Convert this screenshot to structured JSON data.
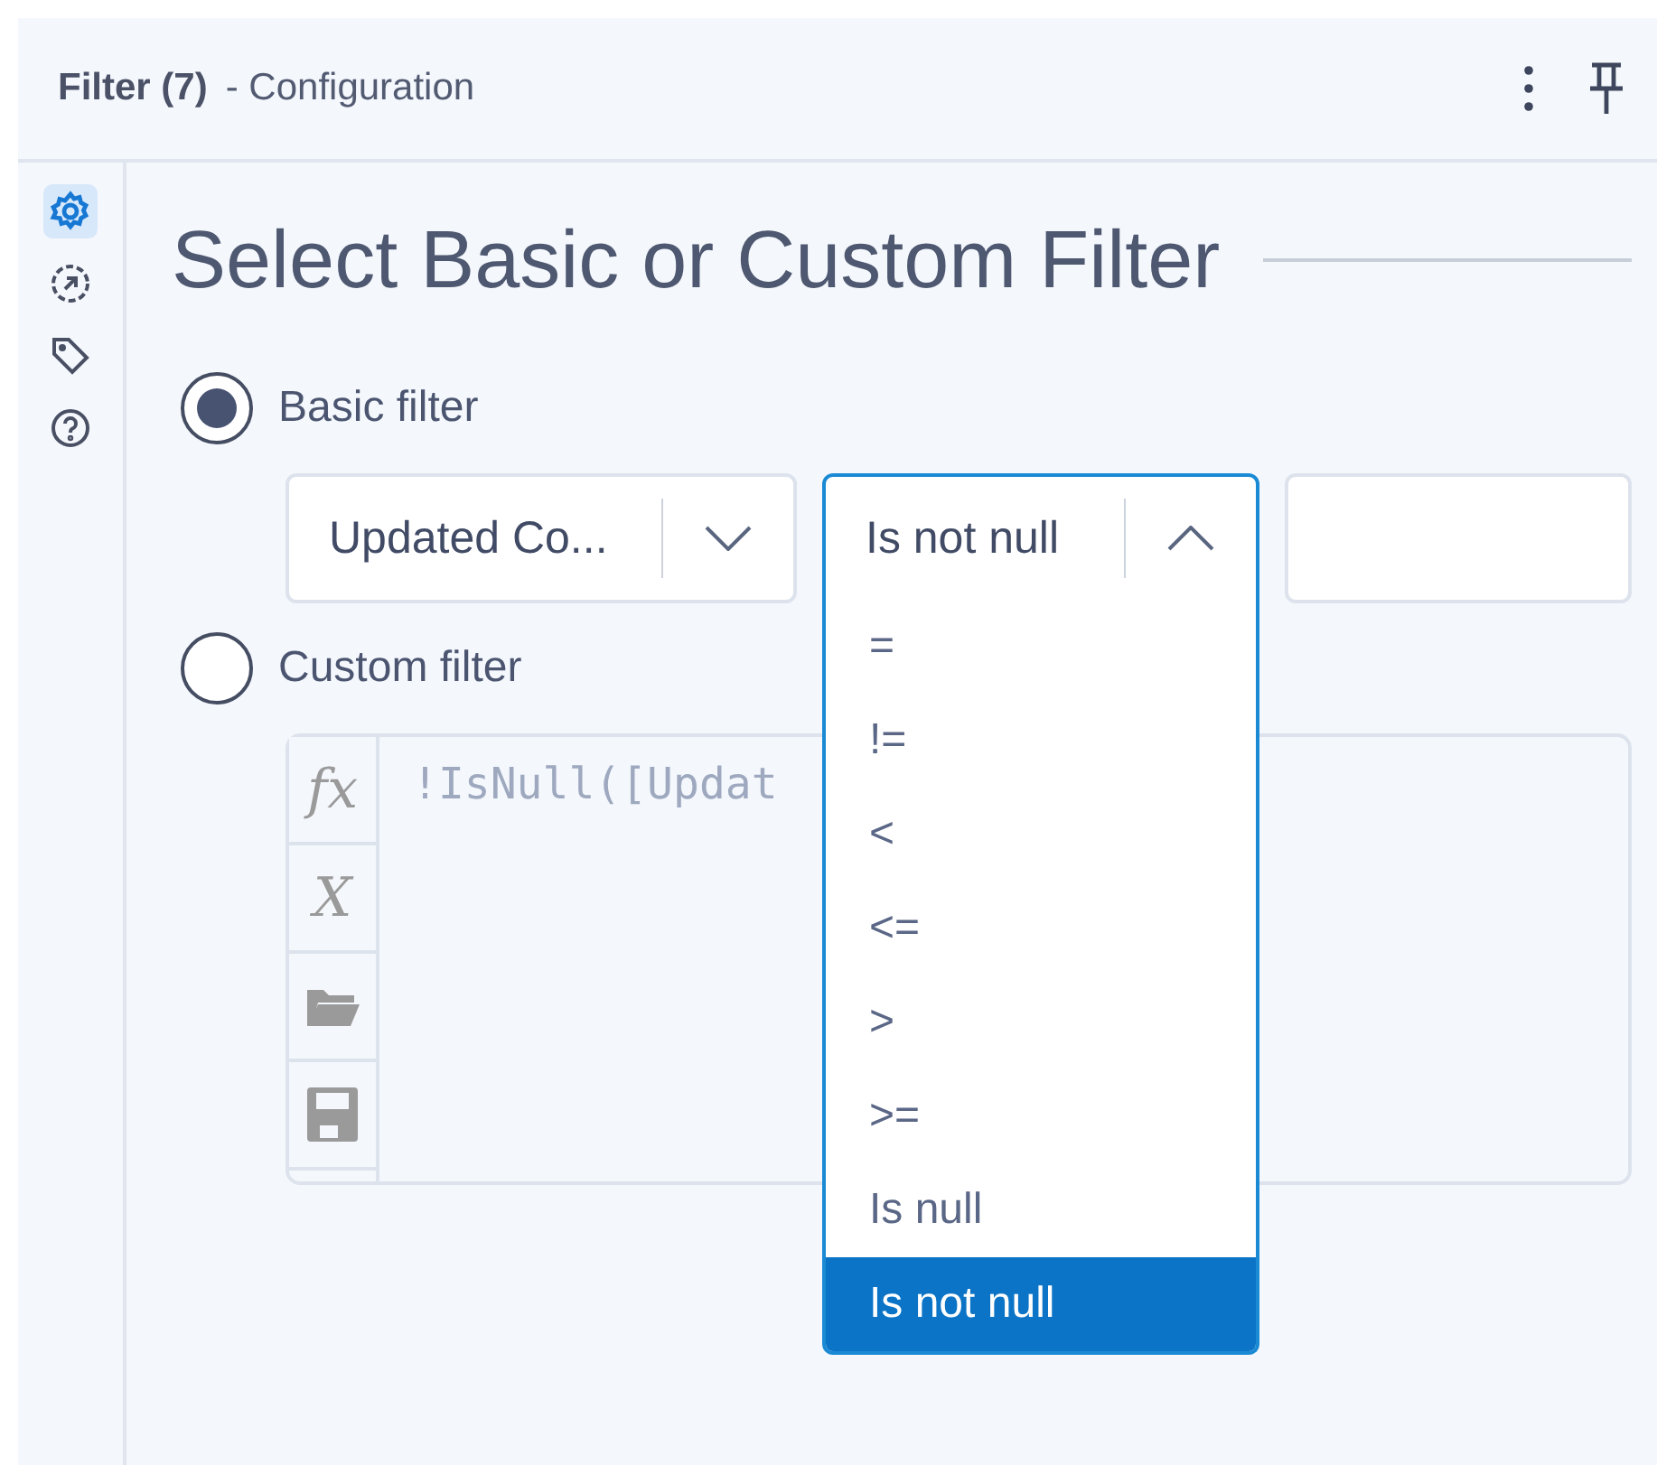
{
  "header": {
    "title": "Filter (7)",
    "subtitle": "- Configuration"
  },
  "rail": [
    {
      "kind": "gear",
      "selected": true
    },
    {
      "kind": "arrow",
      "selected": false
    },
    {
      "kind": "tag",
      "selected": false
    },
    {
      "kind": "help",
      "selected": false
    }
  ],
  "heading": "Select Basic or Custom Filter",
  "options": [
    {
      "label": "Basic filter",
      "selected": true
    },
    {
      "label": "Custom filter",
      "selected": false
    }
  ],
  "basic": {
    "field": "Updated Co...",
    "operator": "Is not null",
    "expanded": true
  },
  "operators": [
    {
      "label": "=",
      "selected": false
    },
    {
      "label": "!=",
      "selected": false
    },
    {
      "label": "<",
      "selected": false
    },
    {
      "label": "<=",
      "selected": false
    },
    {
      "label": ">",
      "selected": false
    },
    {
      "label": ">=",
      "selected": false
    },
    {
      "label": "Is null",
      "selected": false
    },
    {
      "label": "Is not null",
      "selected": true
    }
  ],
  "editor": {
    "text": "!IsNull([Updat",
    "tools": [
      {
        "kind": "text",
        "label": "fx"
      },
      {
        "kind": "text",
        "label": "X"
      },
      {
        "kind": "folder"
      },
      {
        "kind": "save"
      }
    ]
  }
}
